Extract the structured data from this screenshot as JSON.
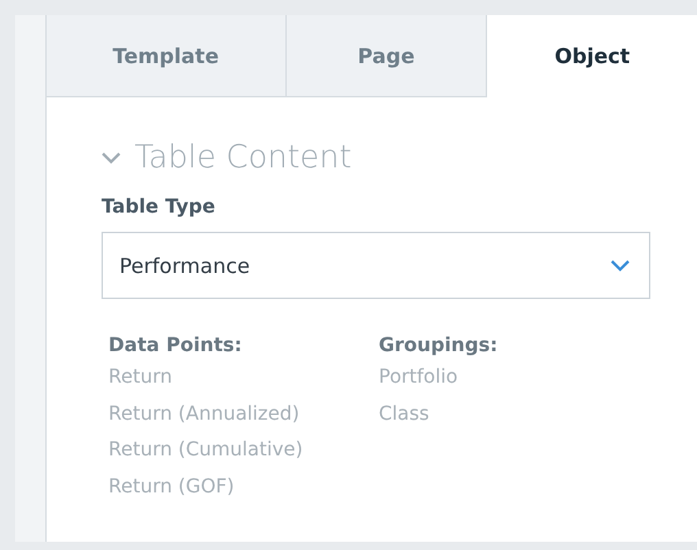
{
  "tabs": [
    {
      "label": "Template",
      "selected": false
    },
    {
      "label": "Page",
      "selected": false
    },
    {
      "label": "Object",
      "selected": true
    }
  ],
  "section": {
    "title": "Table Content",
    "expanded": true
  },
  "table_type": {
    "label": "Table Type",
    "value": "Performance"
  },
  "lists": [
    {
      "heading": "Data Points:",
      "items": [
        "Return",
        "Return (Annualized)",
        "Return (Cumulative)",
        "Return (GOF)"
      ]
    },
    {
      "heading": "Groupings:",
      "items": [
        "Portfolio",
        "Class"
      ]
    }
  ]
}
